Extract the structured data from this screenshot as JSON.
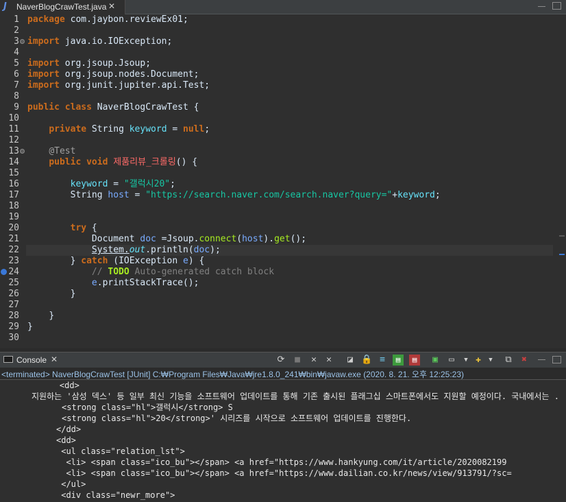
{
  "editor_tab": {
    "icon": "J",
    "title": "NaverBlogCrawTest.java",
    "close": "✕"
  },
  "line_numbers": [
    "1",
    "2",
    "3",
    "4",
    "5",
    "6",
    "7",
    "8",
    "9",
    "10",
    "11",
    "12",
    "13",
    "14",
    "15",
    "16",
    "17",
    "18",
    "19",
    "20",
    "21",
    "22",
    "23",
    "24",
    "25",
    "26",
    "27",
    "28",
    "29",
    "30"
  ],
  "code": {
    "l1": {
      "kw": "package",
      "rest": " com.jaybon.reviewEx01;"
    },
    "l3": {
      "kw": "import",
      "rest": " java.io.IOException;"
    },
    "l5": {
      "kw": "import",
      "rest": " org.jsoup.Jsoup;"
    },
    "l6": {
      "kw": "import",
      "rest": " org.jsoup.nodes.Document;"
    },
    "l7": {
      "kw": "import",
      "rest": " org.junit.jupiter.api.Test;"
    },
    "l9": {
      "kw1": "public",
      "kw2": "class",
      "rest": " NaverBlogCrawTest {"
    },
    "l11": {
      "kw": "private",
      "type": " String ",
      "field": "keyword",
      "eq": " = ",
      "kw2": "null",
      "end": ";"
    },
    "l13": {
      "ann": "@Test"
    },
    "l14": {
      "kw1": "public",
      "kw2": "void",
      "name": " 제품리뷰_크롤링",
      "end": "() {"
    },
    "l16": {
      "field": "keyword",
      "eq": " = ",
      "str": "\"갤럭시20\"",
      "end": ";"
    },
    "l17": {
      "type": "String ",
      "var": "host",
      "eq": " = ",
      "str": "\"https://search.naver.com/search.naver?query=\"",
      "plus": "+",
      "field": "keyword",
      "end": ";"
    },
    "l20": {
      "kw": "try",
      "end": " {"
    },
    "l21": {
      "type": "Document ",
      "var": "doc",
      "eq": " =Jsoup.",
      "meth": "connect",
      "p1": "(",
      "var2": "host",
      "p2": ").",
      "meth2": "get",
      "end": "();"
    },
    "l22": {
      "type": "System.",
      "fld": "out",
      "dot": ".println(",
      "var": "doc",
      "end": ");"
    },
    "l23": {
      "pre": "} ",
      "kw": "catch",
      "mid": " (IOException ",
      "var": "e",
      "end": ") {"
    },
    "l24": {
      "com1": "// ",
      "todo": "TODO",
      "com2": " Auto-generated catch block"
    },
    "l25": {
      "var": "e",
      "rest": ".printStackTrace();"
    },
    "l26": {
      "rest": "}"
    },
    "l28": {
      "rest": "}"
    },
    "l29": {
      "rest": "}"
    }
  },
  "console": {
    "tab_label": "Console",
    "close": "✕",
    "status": "<terminated> NaverBlogCrawTest [JUnit] C:₩Program Files₩Java₩jre1.8.0_241₩bin₩javaw.exe (2020. 8. 21. 오후 12:25:23)",
    "lines": [
      "    <dd>",
      "지원하는 '삼성 덱스' 등 일부 최신 기능을 소프트웨어 업데이트를 통해 기존 출시된 플래그십 스마트폰에서도 지원할 예정이다. 국내에서는 .",
      "<strong class=\"hl\">갤럭시</strong> S",
      "<strong class=\"hl\">20</strong>' 시리즈를 시작으로 소프트웨어 업데이트를 진행한다.",
      "</dd>",
      "<dd>",
      " <ul class=\"relation_lst\">",
      "  <li> <span class=\"ico_bu\"></span> <a href=\"https://www.hankyung.com/it/article/2020082199",
      "  <li> <span class=\"ico_bu\"></span> <a href=\"https://www.dailian.co.kr/news/view/913791/?sc=",
      " </ul>",
      " <div class=\"newr_more\">"
    ]
  }
}
